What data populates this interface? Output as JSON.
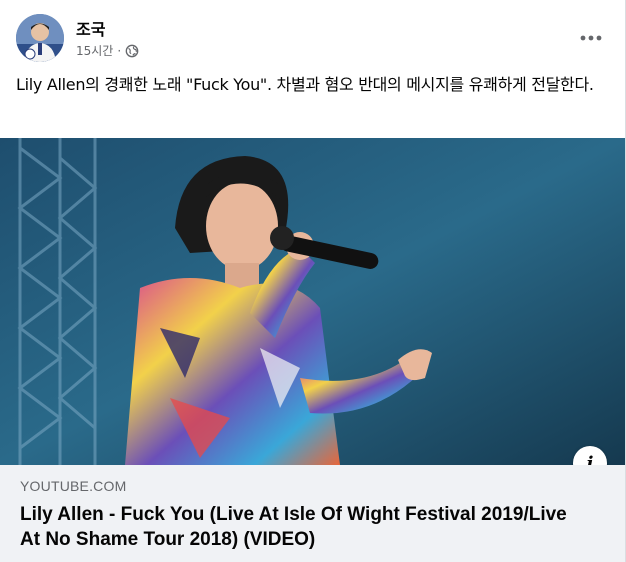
{
  "post": {
    "author": "조국",
    "time": "15시간",
    "separator": "·",
    "privacy_icon": "globe-icon",
    "more_icon": "more-options-icon",
    "text": "Lily Allen의 경쾌한 노래 \"Fuck You\". 차별과 혐오 반대의 메시지를 유쾌하게 전달한다."
  },
  "link": {
    "domain": "YOUTUBE.COM",
    "title": "Lily Allen - Fuck You (Live At Isle Of Wight Festival 2019/Live At No Shame Tour 2018) (VIDEO)",
    "info_icon_label": "i"
  },
  "colors": {
    "text_primary": "#050505",
    "text_secondary": "#65676b",
    "preview_bg": "#f0f2f5"
  }
}
